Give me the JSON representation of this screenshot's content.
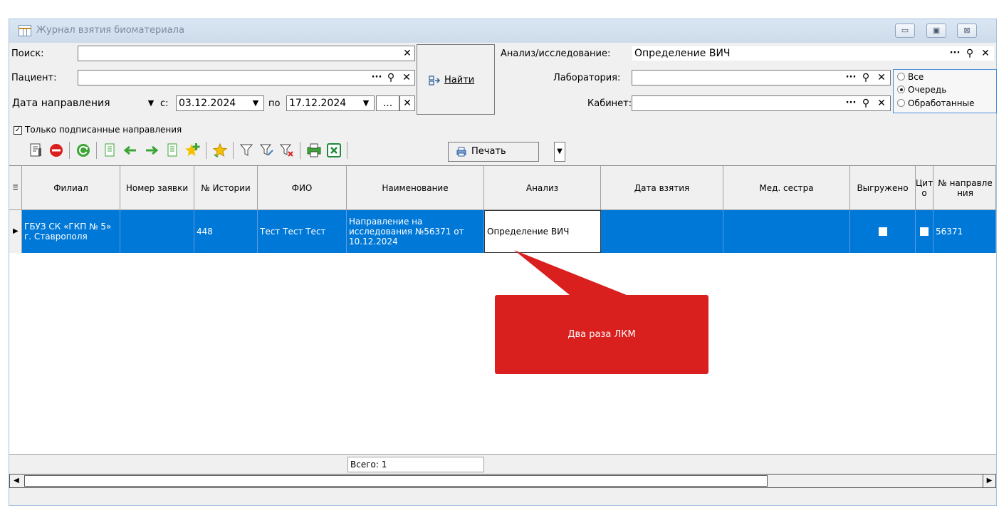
{
  "window": {
    "title": "Журнал взятия биоматериала",
    "btn_minimize": "▭",
    "btn_maximize": "▣",
    "btn_close": "⊠"
  },
  "filters": {
    "search_label": "Поиск:",
    "search_value": "",
    "patient_label": "Пациент:",
    "patient_value": "",
    "date_type": "Дата направления",
    "from_label": "с:",
    "from_date": "03.12.2024",
    "to_label": "по",
    "to_date": "17.12.2024",
    "dots": "...",
    "find_label": "Найти",
    "analysis_label": "Анализ/исследование:",
    "analysis_value": "Определение ВИЧ",
    "lab_label": "Лаборатория:",
    "lab_value": "",
    "cabinet_label": "Кабинет:",
    "cabinet_value": "",
    "only_signed_label": "Только подписанные направления",
    "only_signed_checked": true
  },
  "status_radio": {
    "options": [
      "Все",
      "Очередь",
      "Обработанные"
    ],
    "selected": "Очередь"
  },
  "toolbar": {
    "print_label": "Печать"
  },
  "grid": {
    "columns": [
      "Филиал",
      "Номер заявки",
      "№ Истории",
      "ФИО",
      "Наименование",
      "Анализ",
      "Дата взятия",
      "Мед. сестра",
      "Выгружено",
      "Цит о",
      "№ направле ния"
    ],
    "rows": [
      {
        "branch": "ГБУЗ СК «ГКП № 5» г. Ставрополя",
        "request_no": "",
        "history_no": "448",
        "fio": "Тест Тест Тест",
        "name": "Направление на исследования №56371 от 10.12.2024",
        "analysis": "Определение ВИЧ",
        "take_date": "",
        "nurse": "",
        "uploaded": false,
        "cyto": false,
        "referral_no": "56371"
      }
    ],
    "total_label": "Всего: 1"
  },
  "callout": {
    "text": "Два раза ЛКМ",
    "color": "#d9201f"
  },
  "colors": {
    "selection": "#0078d7",
    "accent": "#4a90d9"
  }
}
